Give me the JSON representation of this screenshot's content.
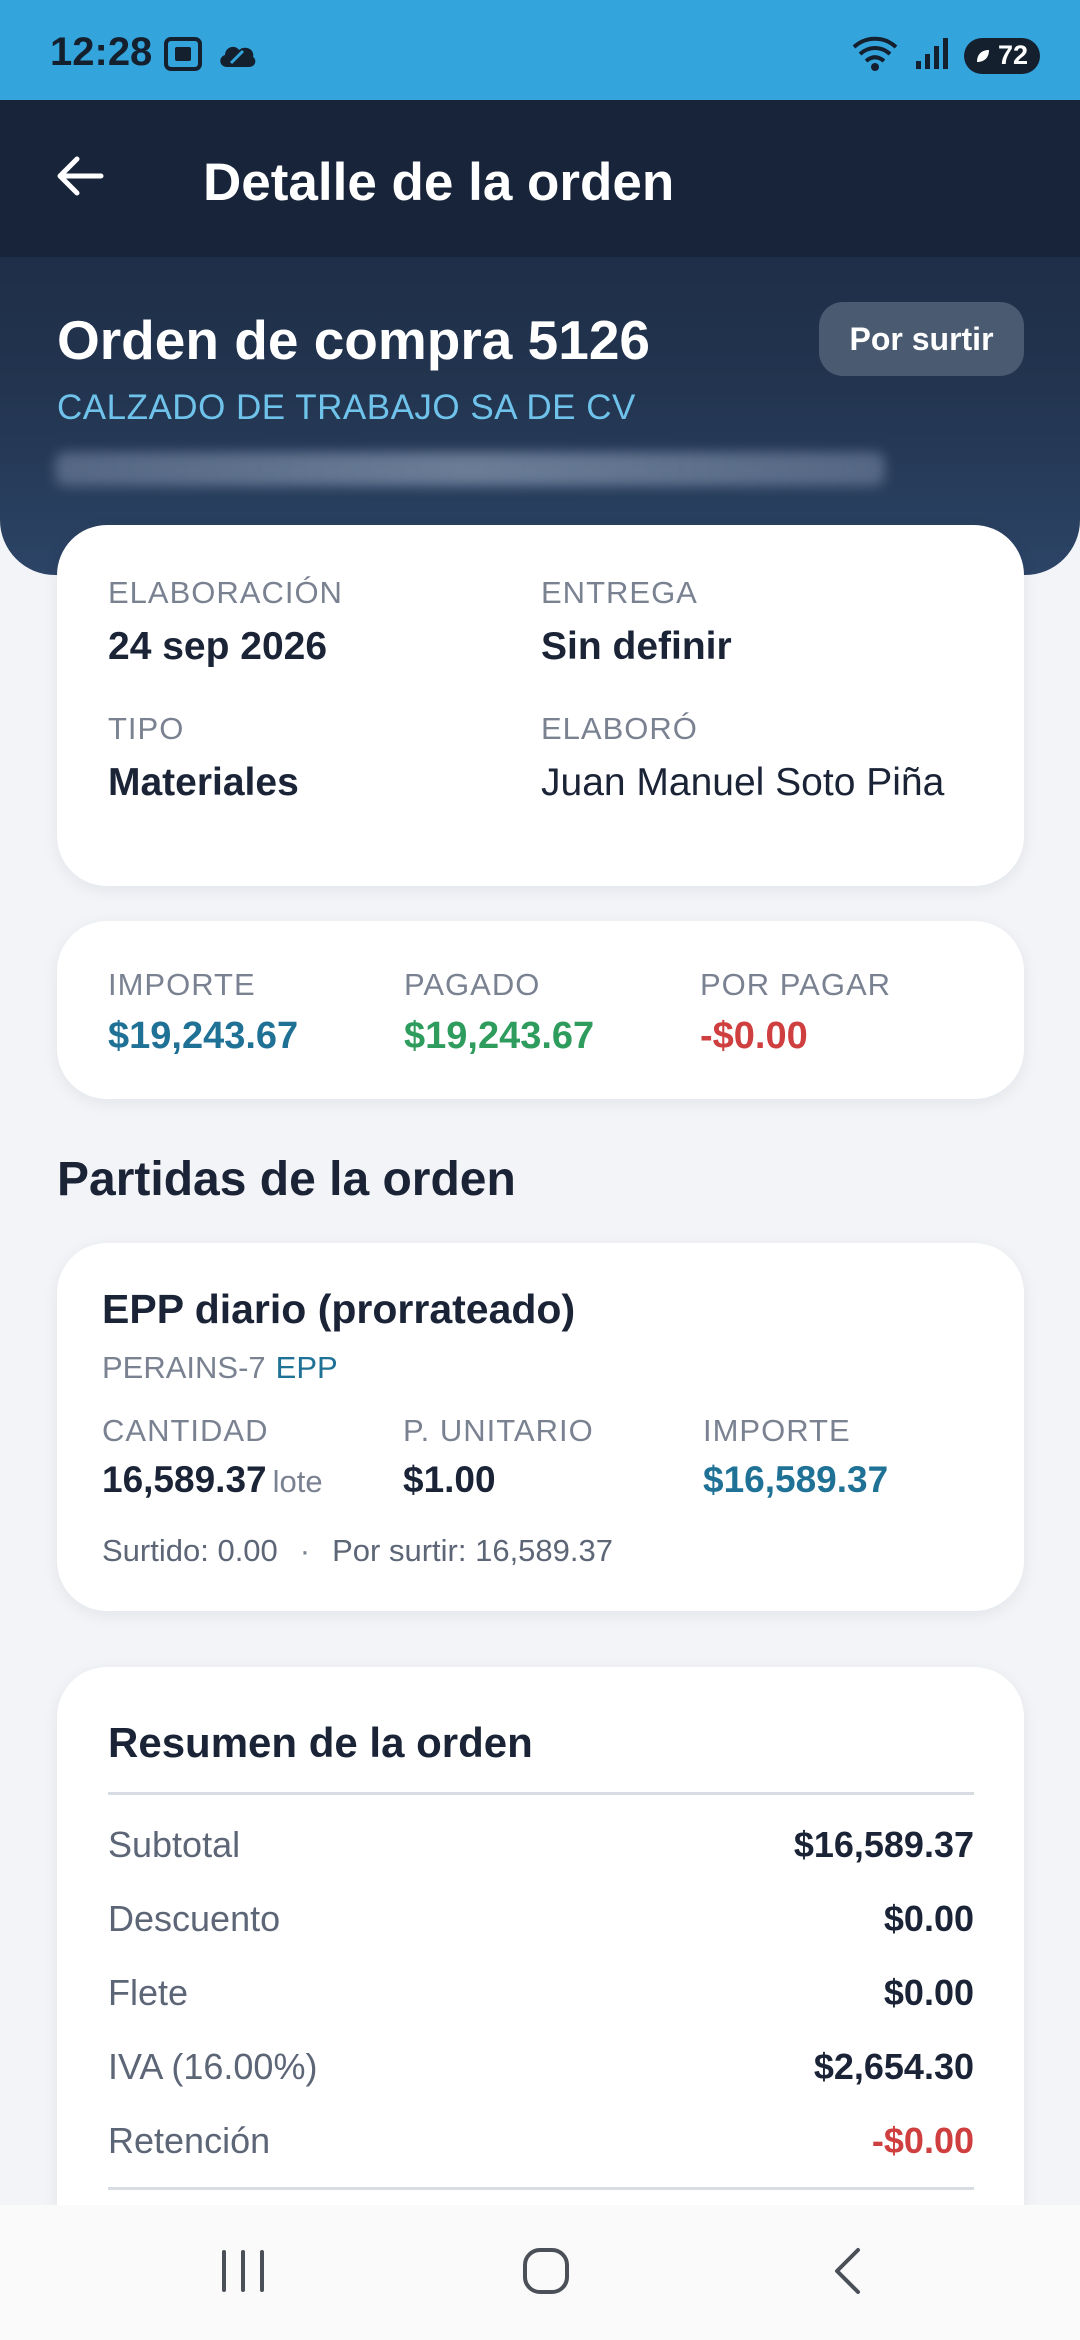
{
  "status_bar": {
    "time": "12:28",
    "battery": "72",
    "icons": [
      "screenshot-icon",
      "cloud-icon",
      "wifi-icon",
      "signal-icon",
      "battery-icon"
    ]
  },
  "app_bar": {
    "title": "Detalle de la orden",
    "back_icon": "arrow-left-icon"
  },
  "order": {
    "title": "Orden de compra 5126",
    "status": "Por surtir",
    "supplier": "CALZADO DE TRABAJO SA DE CV"
  },
  "info": {
    "elaboracion_label": "ELABORACIÓN",
    "elaboracion_value": "24 sep 2026",
    "entrega_label": "ENTREGA",
    "entrega_value": "Sin definir",
    "tipo_label": "TIPO",
    "tipo_value": "Materiales",
    "elaboro_label": "ELABORÓ",
    "elaboro_value": "Juan Manuel Soto Piña"
  },
  "totals": {
    "importe_label": "IMPORTE",
    "importe_value": "$19,243.67",
    "pagado_label": "PAGADO",
    "pagado_value": "$19,243.67",
    "por_pagar_label": "POR PAGAR",
    "por_pagar_value": "-$0.00"
  },
  "items_section": {
    "title": "Partidas de la orden",
    "items": [
      {
        "name": "EPP diario (prorrateado)",
        "code": "PERAINS-7",
        "tag": "EPP",
        "cantidad_label": "CANTIDAD",
        "cantidad_value": "16,589.37",
        "unit": "lote",
        "unitario_label": "P. UNITARIO",
        "unitario_value": "$1.00",
        "importe_label": "IMPORTE",
        "importe_value": "$16,589.37",
        "surtido": "Surtido: 0.00",
        "separator": "·",
        "por_surtir": "Por surtir: 16,589.37"
      }
    ]
  },
  "summary": {
    "title": "Resumen de la orden",
    "rows": [
      {
        "label": "Subtotal",
        "value": "$16,589.37"
      },
      {
        "label": "Descuento",
        "value": "$0.00"
      },
      {
        "label": "Flete",
        "value": "$0.00"
      },
      {
        "label": "IVA (16.00%)",
        "value": "$2,654.30"
      },
      {
        "label": "Retención",
        "value": "-$0.00"
      }
    ]
  },
  "colors": {
    "status_bar": "#34a4dc",
    "header": "#18243a",
    "accent_blue": "#1f7196",
    "positive_green": "#2e9c5d",
    "negative_red": "#cf3f3f"
  },
  "nav_bar": {
    "icons": [
      "recent-apps-icon",
      "home-icon",
      "back-nav-icon"
    ]
  }
}
